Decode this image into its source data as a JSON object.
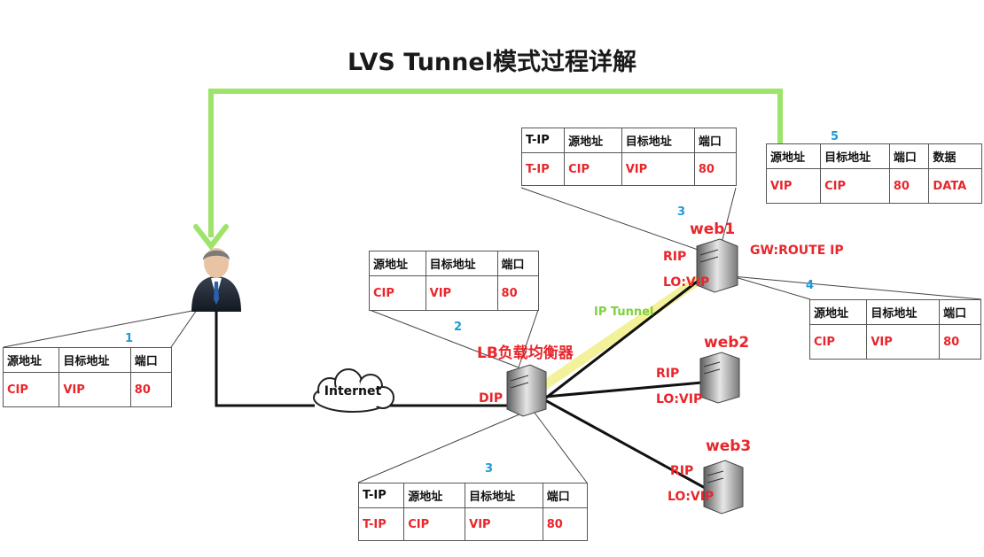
{
  "title": "LVS Tunnel模式过程详解",
  "internet_label": "Internet",
  "lb": {
    "name": "LB负载均衡器",
    "dip": "DIP"
  },
  "web1": {
    "name": "web1",
    "rip": "RIP",
    "lo": "LO:VIP",
    "gw": "GW:ROUTE IP"
  },
  "web2": {
    "name": "web2",
    "rip": "RIP",
    "lo": "LO:VIP"
  },
  "web3": {
    "name": "web3",
    "rip": "RIP",
    "lo": "LO:VIP"
  },
  "tunnel_label": "IP Tunnel",
  "steps": [
    "1",
    "2",
    "3",
    "3",
    "4",
    "5"
  ],
  "tables": {
    "t1": {
      "headers": [
        "源地址",
        "目标地址",
        "端口"
      ],
      "values": [
        "CIP",
        "VIP",
        "80"
      ]
    },
    "t2": {
      "headers": [
        "源地址",
        "目标地址",
        "端口"
      ],
      "values": [
        "CIP",
        "VIP",
        "80"
      ]
    },
    "t3": {
      "headers": [
        "T-IP",
        "源地址",
        "目标地址",
        "端口"
      ],
      "values": [
        "T-IP",
        "CIP",
        "VIP",
        "80"
      ]
    },
    "t3b": {
      "headers": [
        "T-IP",
        "源地址",
        "目标地址",
        "端口"
      ],
      "values": [
        "T-IP",
        "CIP",
        "VIP",
        "80"
      ]
    },
    "t4": {
      "headers": [
        "源地址",
        "目标地址",
        "端口"
      ],
      "values": [
        "CIP",
        "VIP",
        "80"
      ]
    },
    "t5": {
      "headers": [
        "源地址",
        "目标地址",
        "端口",
        "数据"
      ],
      "values": [
        "VIP",
        "CIP",
        "80",
        "DATA"
      ]
    }
  },
  "colors": {
    "arrow": "#9ee36a",
    "text_red": "#e8262b",
    "step_blue": "#1e9ad6",
    "tunnel": "#f3f19a"
  }
}
